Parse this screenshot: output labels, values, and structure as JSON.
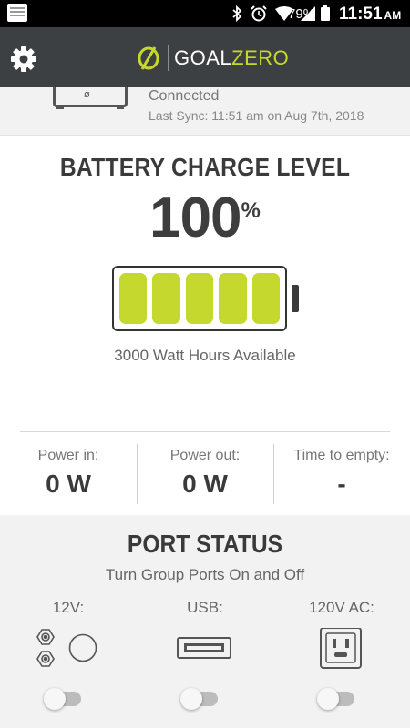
{
  "status_bar": {
    "battery_percent": "79%",
    "time": "11:51",
    "ampm": "AM",
    "icons": [
      "app-notification-icon",
      "bluetooth-icon",
      "alarm-icon",
      "wifi-icon",
      "cellular-signal-icon",
      "battery-icon"
    ]
  },
  "header": {
    "logo_word_1": "GOAL",
    "logo_word_2": "ZERO",
    "settings_icon": "gear-icon",
    "colors": {
      "bar": "#3d4043",
      "accent": "#c7d82b"
    }
  },
  "device": {
    "device_symbol": "ø",
    "connection_status": "Connected",
    "last_sync": "Last Sync: 11:51 am on Aug 7th, 2018"
  },
  "battery": {
    "title": "BATTERY CHARGE LEVEL",
    "percent_value": "100",
    "percent_unit": "%",
    "filled_cells": 5,
    "total_cells": 5,
    "watt_hours": "3000 Watt Hours Available",
    "cell_color": "#c4d82e"
  },
  "stats": [
    {
      "label": "Power in:",
      "value": "0 W"
    },
    {
      "label": "Power out:",
      "value": "0 W"
    },
    {
      "label": "Time to empty:",
      "value": "-"
    }
  ],
  "ports": {
    "title": "PORT STATUS",
    "subtitle": "Turn Group Ports On and Off",
    "groups": [
      {
        "label": "12V:",
        "icon": "12v-port-icon",
        "enabled": false
      },
      {
        "label": "USB:",
        "icon": "usb-port-icon",
        "enabled": false
      },
      {
        "label": "120V AC:",
        "icon": "ac-outlet-icon",
        "enabled": false
      }
    ]
  }
}
